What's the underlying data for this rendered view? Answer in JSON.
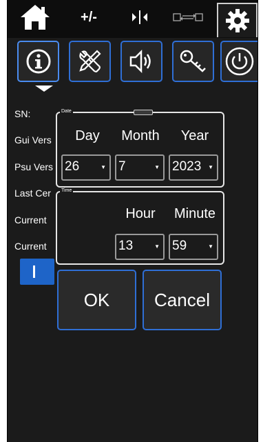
{
  "tabs": [
    {
      "name": "home",
      "icon": "home-icon"
    },
    {
      "name": "plus-minus",
      "label": "+/-"
    },
    {
      "name": "split",
      "icon": "split-icon"
    },
    {
      "name": "swap",
      "icon": "swap-icon"
    },
    {
      "name": "settings",
      "icon": "gear-icon",
      "active": true
    }
  ],
  "icon_buttons": [
    {
      "icon": "info-icon",
      "active": true
    },
    {
      "icon": "tools-icon"
    },
    {
      "icon": "speaker-icon"
    },
    {
      "icon": "key-icon"
    },
    {
      "icon": "power-icon"
    }
  ],
  "info": {
    "sn": "SN:",
    "gui_version": "Gui Vers",
    "psu_version": "Psu Vers",
    "last_cert": "Last Cer",
    "current1": "Current",
    "current2": "Current"
  },
  "date_group": {
    "title": "Date",
    "day_label": "Day",
    "month_label": "Month",
    "year_label": "Year",
    "day_value": "26",
    "month_value": "7",
    "year_value": "2023"
  },
  "time_group": {
    "title": "Time",
    "hour_label": "Hour",
    "minute_label": "Minute",
    "hour_value": "13",
    "minute_value": "59"
  },
  "buttons": {
    "ok": "OK",
    "cancel": "Cancel"
  },
  "colors": {
    "accent": "#2f6fd6",
    "background": "#1b1b1b",
    "toggle": "#1e64c8"
  }
}
